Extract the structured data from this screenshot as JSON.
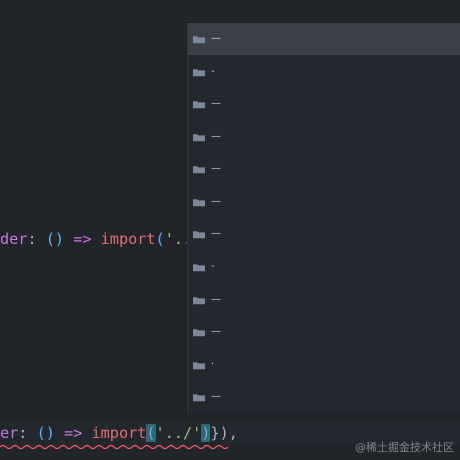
{
  "editor": {
    "line_1": {
      "prop": "der",
      "colon": ":",
      "params": "()",
      "arrow": "=>",
      "keyword": "import",
      "paren_open": "(",
      "string": "'.."
    },
    "line_2": {
      "prop": "er",
      "colon": ":",
      "params": "()",
      "arrow": "=>",
      "keyword": "import",
      "paren_open": "(",
      "string": "'../'",
      "paren_close": ")",
      "tail": "}),"
    }
  },
  "suggestions": [
    {
      "label": "—",
      "icon": "folder-icon"
    },
    {
      "label": "-",
      "icon": "folder-icon"
    },
    {
      "label": "—",
      "icon": "folder-icon"
    },
    {
      "label": "—",
      "icon": "folder-icon"
    },
    {
      "label": "—",
      "icon": "folder-icon"
    },
    {
      "label": "—",
      "icon": "folder-icon"
    },
    {
      "label": "—",
      "icon": "folder-icon"
    },
    {
      "label": "-",
      "icon": "folder-icon"
    },
    {
      "label": "—",
      "icon": "folder-icon"
    },
    {
      "label": "—",
      "icon": "folder-icon"
    },
    {
      "label": "·",
      "icon": "folder-icon"
    },
    {
      "label": "—",
      "icon": "folder-icon"
    }
  ],
  "watermark": "@稀土掘金技术社区",
  "colors": {
    "background": "#212529",
    "suggest_background": "#23272e",
    "selected_row": "#3a4046",
    "property": "#c678dd",
    "keyword": "#e06c75",
    "paren": "#61afef",
    "bracket_match": "#2f6b6e",
    "error_squiggle": "#ff5f6d",
    "folder_icon": "#7c879b"
  }
}
